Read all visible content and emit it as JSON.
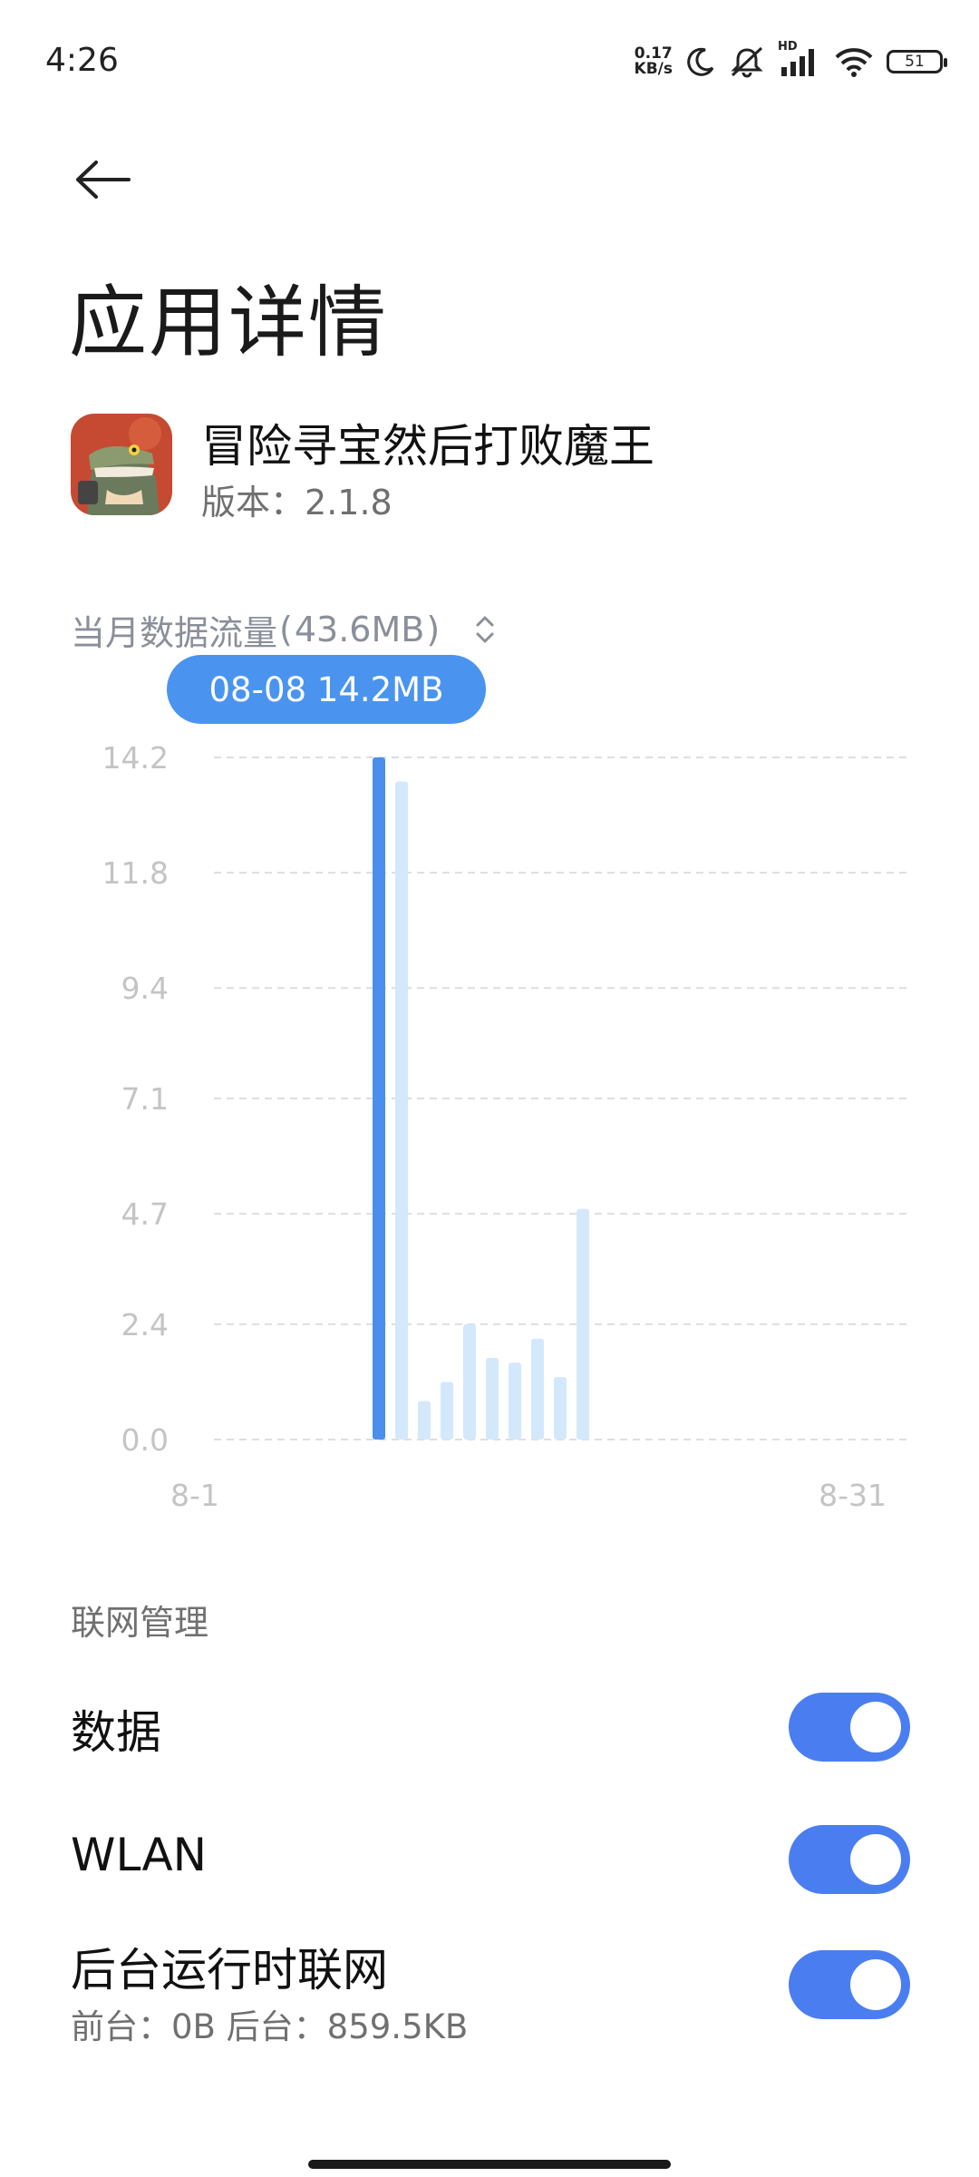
{
  "status_bar": {
    "time": "4:26",
    "net_speed_value": "0.17",
    "net_speed_unit": "KB/s",
    "signal_label": "HD",
    "battery": "51",
    "icons": [
      "moon-icon",
      "mute-bell-icon",
      "signal-icon",
      "wifi-icon",
      "battery-icon"
    ]
  },
  "header": {
    "back_icon": "arrow-left-icon",
    "title": "应用详情"
  },
  "app": {
    "name": "冒险寻宝然后打败魔王",
    "version_label": "版本：",
    "version": "2.1.8"
  },
  "data_usage": {
    "selector_label": "当月数据流量",
    "selector_paren_open": "(",
    "selector_total": " 43.6MB ",
    "selector_paren_close": ")",
    "tooltip": "08-08 14.2MB"
  },
  "chart_data": {
    "type": "bar",
    "x_start_label": "8-1",
    "x_end_label": "8-31",
    "days": 31,
    "ylim": [
      0,
      14.2
    ],
    "y_ticks": [
      "14.2",
      "11.8",
      "9.4",
      "7.1",
      "4.7",
      "2.4",
      "0.0"
    ],
    "y_tick_values": [
      14.2,
      11.8,
      9.4,
      7.1,
      4.7,
      2.4,
      0.0
    ],
    "grid": true,
    "selected_index": 7,
    "values": [
      0,
      0,
      0,
      0,
      0,
      0,
      0,
      14.2,
      13.7,
      0.8,
      1.2,
      2.4,
      1.7,
      1.6,
      2.1,
      1.3,
      4.8,
      0,
      0,
      0,
      0,
      0,
      0,
      0,
      0,
      0,
      0,
      0,
      0,
      0,
      0
    ],
    "colors": {
      "selected": "#4a8fed",
      "normal": "#d4e8fb",
      "grid": "#dedede",
      "tick_text": "#c4c4c4"
    }
  },
  "network": {
    "section_label": "联网管理",
    "items": [
      {
        "title": "数据",
        "enabled": true
      },
      {
        "title": "WLAN",
        "enabled": true
      },
      {
        "title": "后台运行时联网",
        "subtitle": "前台：0B  后台：859.5KB",
        "enabled": true
      }
    ]
  },
  "colors": {
    "accent": "#4a7ef0",
    "tooltip": "#4a94f0"
  }
}
